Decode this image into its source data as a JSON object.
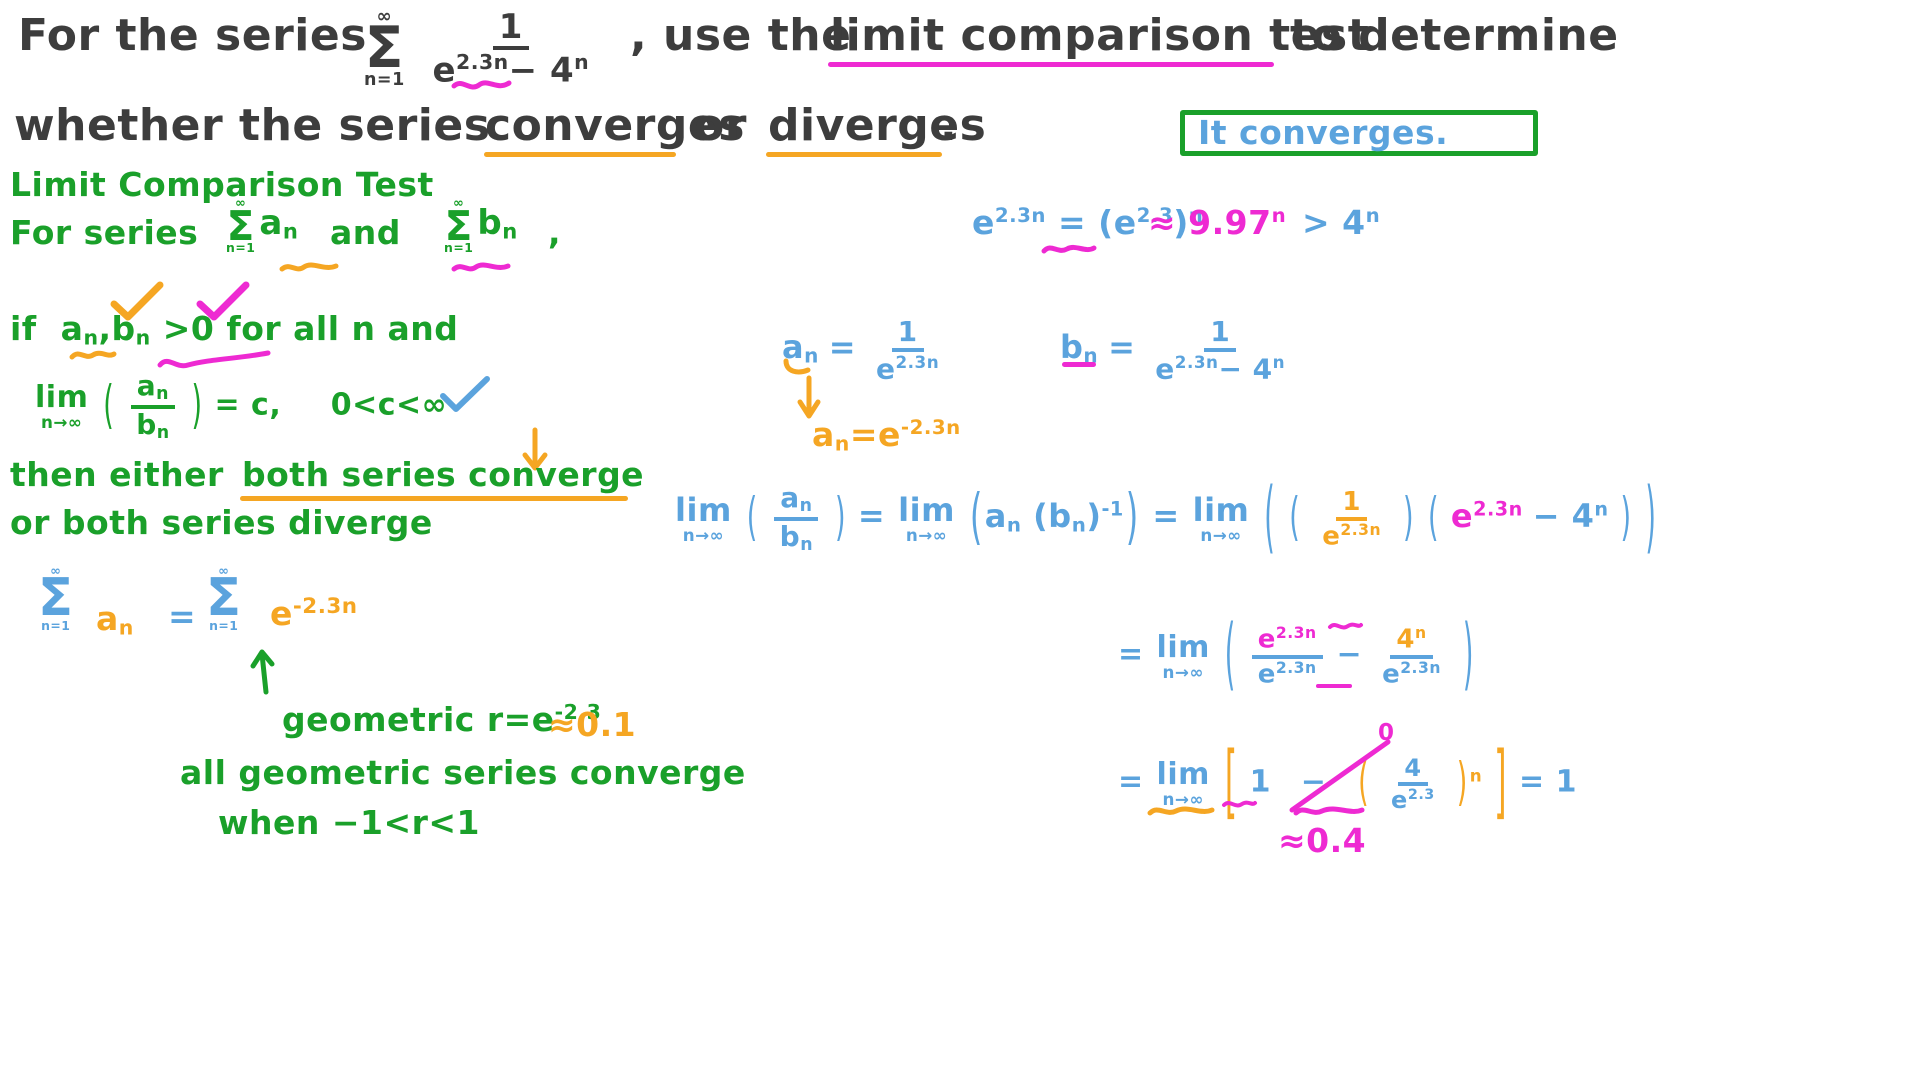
{
  "meta": {
    "kind": "handwritten-math-worksheet",
    "topic": "Limit Comparison Test",
    "colors": {
      "question_ink": "#3d3d3d",
      "theory_ink": "#1aa02a",
      "work_ink": "#5ba3dd",
      "highlight_orange": "#f5a623",
      "highlight_magenta": "#ee2ad2",
      "background": "#ffffff"
    }
  },
  "question": {
    "line1_a": "For the series",
    "sum": {
      "top": "∞",
      "sym": "Σ",
      "bottom": "n=1"
    },
    "term": {
      "numerator": "1",
      "den_base": "e",
      "den_exp": "2.3n",
      "den_minus": "− 4",
      "den_minus_exp": "n"
    },
    "line1_b": ", use the",
    "underlined_phrase": "limit comparison test",
    "line1_c": "to determine",
    "line2_a": "whether the series",
    "word_converges": "converges",
    "line2_b": "or",
    "word_diverges": "diverges",
    "line2_c": "."
  },
  "answer": {
    "text": "It converges.",
    "box_color": "#1aa02a",
    "text_color": "#5ba3dd"
  },
  "theory": {
    "title": "Limit Comparison Test",
    "line_for_series": "For series",
    "sum_a": {
      "top": "∞",
      "sym": "Σ",
      "bottom": "n=1",
      "term": "a",
      "termsub": "n"
    },
    "and": "and",
    "sum_b": {
      "top": "∞",
      "sym": "Σ",
      "bottom": "n=1",
      "term": "b",
      "termsub": "n"
    },
    "comma": ",",
    "condition_if": "if",
    "condition_a": "a",
    "condition_a_sub": "n",
    "condition_comma": ",",
    "condition_b": "b",
    "condition_b_sub": "n",
    "condition_gt": ">0",
    "condition_rest": "for all n and",
    "limit_word": "lim",
    "limit_under": "n→∞",
    "limit_num": "a",
    "limit_num_sub": "n",
    "limit_den": "b",
    "limit_den_sub": "n",
    "limit_eq": "= c,",
    "limit_range": "0<c<∞",
    "conclusion_1": "then either",
    "conclusion_underlined": "both series converge",
    "conclusion_2": "or both series diverge",
    "check_orange": "✓",
    "check_magenta": "✓",
    "check_blue": "✓"
  },
  "geometric": {
    "sum": {
      "top": "∞",
      "sym": "Σ",
      "bottom": "n=1"
    },
    "a_n": "a",
    "a_n_sub": "n",
    "equals": "=",
    "sum2": {
      "top": "∞",
      "sym": "Σ",
      "bottom": "n=1"
    },
    "e_base": "e",
    "e_exp": "-2.3n",
    "note_1": "geometric  r=e",
    "note_1_exp": "-2.3",
    "note_1_approx": "≈0.1",
    "note_2": "all geometric series converge",
    "note_3": "when   −1<r<1",
    "arrow": "↑"
  },
  "work": {
    "exp_compare": {
      "lhs_base": "e",
      "lhs_exp": "2.3n",
      "eq": "=",
      "mid_open": "(",
      "mid_base": "e",
      "mid_exp": "2.3",
      "mid_close": ")",
      "mid_pow": "n",
      "approx": "≈ 9.97",
      "approx_pow": "n",
      "gt": "> 4",
      "gt_pow": "n"
    },
    "a_def": {
      "lhs": "a",
      "lhs_sub": "n",
      "eq": "=",
      "num": "1",
      "den_base": "e",
      "den_exp": "2.3n"
    },
    "a_simplified": {
      "lhs": "a",
      "lhs_sub": "n",
      "eq": "=",
      "base": "e",
      "exp": "-2.3n"
    },
    "b_def": {
      "lhs": "b",
      "lhs_sub": "n",
      "eq": "=",
      "num": "1",
      "den_base": "e",
      "den_exp": "2.3n",
      "den_tail": "− 4",
      "den_tail_exp": "n"
    },
    "limit_chain": {
      "lim1": "lim",
      "lim1_sub": "n→∞",
      "frac_num": "a",
      "frac_num_sub": "n",
      "frac_den": "b",
      "frac_den_sub": "n",
      "eq1": "=",
      "lim2": "lim",
      "lim2_sub": "n→∞",
      "expr2_a": "a",
      "expr2_a_sub": "n",
      "expr2_b": "b",
      "expr2_b_sub": "n",
      "expr2_pow": "-1",
      "eq2": "=",
      "lim3": "lim",
      "lim3_sub": "n→∞",
      "expr3_num": "1",
      "expr3_den_base": "e",
      "expr3_den_exp": "2.3n",
      "expr3_second_base": "e",
      "expr3_second_exp": "2.3n",
      "expr3_minus": "− 4",
      "expr3_minus_exp": "n"
    },
    "step_split": {
      "eq": "=",
      "lim": "lim",
      "lim_sub": "n→∞",
      "t1_num_base": "e",
      "t1_num_exp": "2.3n",
      "t1_den_base": "e",
      "t1_den_exp": "2.3n",
      "minus": "−",
      "t2_num": "4",
      "t2_num_exp": "n",
      "t2_den_base": "e",
      "t2_den_exp": "2.3n"
    },
    "step_final": {
      "eq": "=",
      "lim": "lim",
      "lim_sub": "n→∞",
      "one": "1",
      "minus": "−",
      "frac_num": "4",
      "frac_den_base": "e",
      "frac_den_exp": "2.3",
      "pow": "n",
      "result": "= 1",
      "zero_label": "0",
      "approx_label": "≈0.4"
    }
  }
}
